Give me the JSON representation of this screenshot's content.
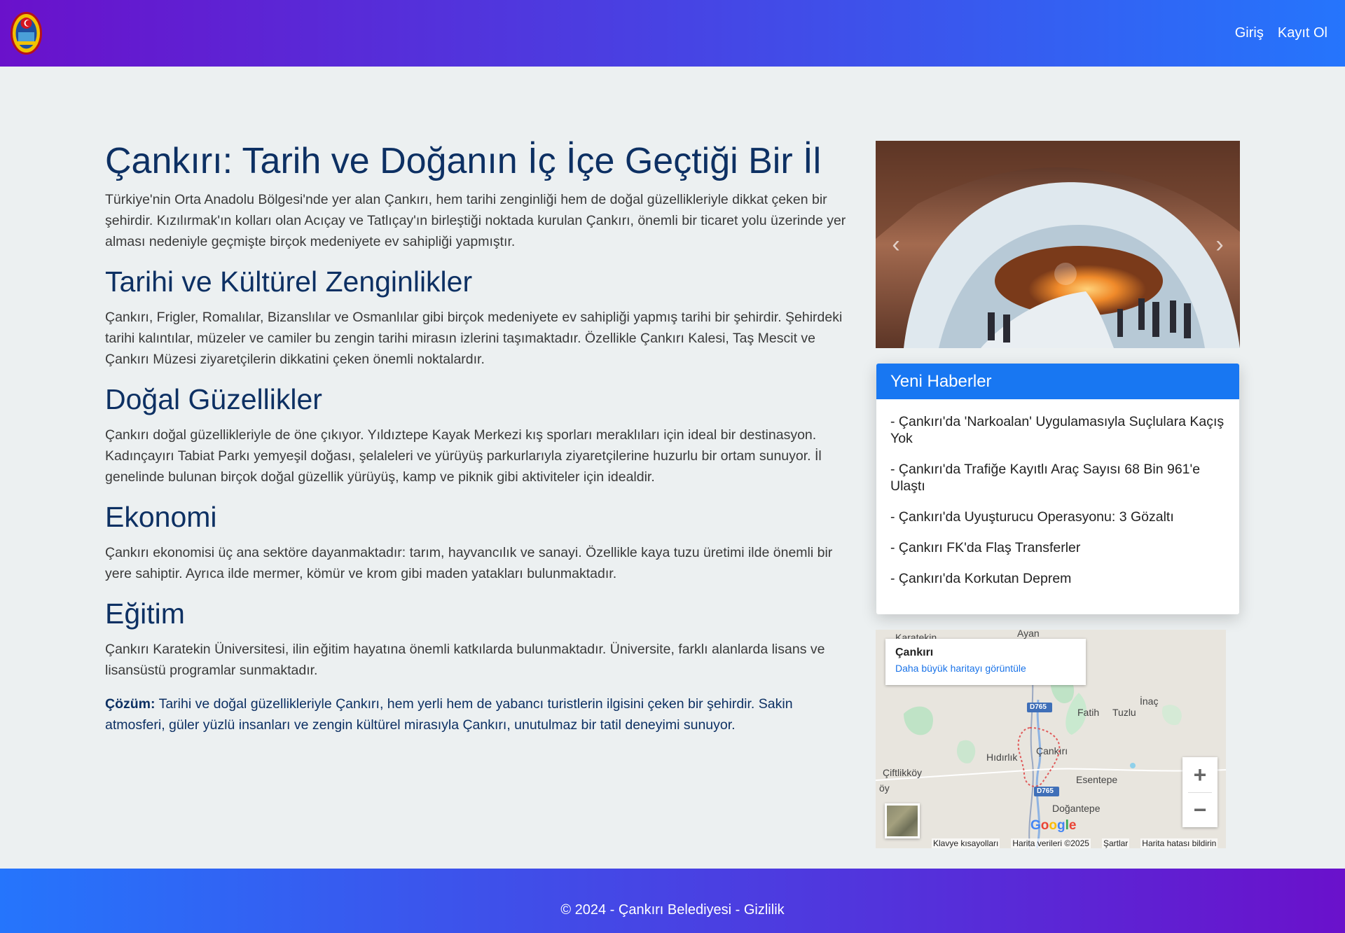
{
  "header": {
    "nav": [
      "Giriş",
      "Kayıt Ol"
    ]
  },
  "main": {
    "title": "Çankırı: Tarih ve Doğanın İç İçe Geçtiği Bir İl",
    "intro": "Türkiye'nin Orta Anadolu Bölgesi'nde yer alan Çankırı, hem tarihi zenginliği hem de doğal güzellikleriyle dikkat çeken bir şehirdir. Kızılırmak'ın kolları olan Acıçay ve Tatlıçay'ın birleştiği noktada kurulan Çankırı, önemli bir ticaret yolu üzerinde yer alması nedeniyle geçmişte birçok medeniyete ev sahipliği yapmıştır.",
    "sections": [
      {
        "heading": "Tarihi ve Kültürel Zenginlikler",
        "text": "Çankırı, Frigler, Romalılar, Bizanslılar ve Osmanlılar gibi birçok medeniyete ev sahipliği yapmış tarihi bir şehirdir. Şehirdeki tarihi kalıntılar, müzeler ve camiler bu zengin tarihi mirasın izlerini taşımaktadır. Özellikle Çankırı Kalesi, Taş Mescit ve Çankırı Müzesi ziyaretçilerin dikkatini çeken önemli noktalardır."
      },
      {
        "heading": "Doğal Güzellikler",
        "text": "Çankırı doğal güzellikleriyle de öne çıkıyor. Yıldıztepe Kayak Merkezi kış sporları meraklıları için ideal bir destinasyon. Kadınçayırı Tabiat Parkı yemyeşil doğası, şelaleleri ve yürüyüş parkurlarıyla ziyaretçilerine huzurlu bir ortam sunuyor. İl genelinde bulunan birçok doğal güzellik yürüyüş, kamp ve piknik gibi aktiviteler için idealdir."
      },
      {
        "heading": "Ekonomi",
        "text": "Çankırı ekonomisi üç ana sektöre dayanmaktadır: tarım, hayvancılık ve sanayi. Özellikle kaya tuzu üretimi ilde önemli bir yere sahiptir. Ayrıca ilde mermer, kömür ve krom gibi maden yatakları bulunmaktadır."
      },
      {
        "heading": "Eğitim",
        "text": "Çankırı Karatekin Üniversitesi, ilin eğitim hayatına önemli katkılarda bulunmaktadır. Üniversite, farklı alanlarda lisans ve lisansüstü programlar sunmaktadır."
      }
    ],
    "solution_label": "Çözüm:",
    "solution_text": " Tarihi ve doğal güzellikleriyle Çankırı, hem yerli hem de yabancı turistlerin ilgisini çeken bir şehirdir. Sakin atmosferi, güler yüzlü insanları ve zengin kültürel mirasıyla Çankırı, unutulmaz bir tatil deneyimi sunuyor."
  },
  "carousel": {
    "prev": "‹",
    "next": "›"
  },
  "news": {
    "title": "Yeni Haberler",
    "items": [
      "- Çankırı'da 'Narkoalan' Uygulamasıyla Suçlulara Kaçış Yok",
      "- Çankırı'da Trafiğe Kayıtlı Araç Sayısı 68 Bin 961'e Ulaştı",
      "- Çankırı'da Uyuşturucu Operasyonu: 3 Gözaltı",
      "- Çankırı FK'da Flaş Transferler",
      "- Çankırı'da Korkutan Deprem"
    ]
  },
  "map": {
    "place": "Çankırı",
    "link": "Daha büyük haritayı görüntüle",
    "labels": [
      "Karatekin",
      "Ayan",
      "İnaç",
      "Fatih",
      "Tuzlu",
      "Çankırı",
      "Hıdırlık",
      "Çiftlikköy",
      "öy",
      "Esentepe",
      "Doğantepe",
      "D765",
      "D765"
    ],
    "zoom_in": "+",
    "zoom_out": "−",
    "google": "Google",
    "footer": [
      "Klavye kısayolları",
      "Harita verileri ©2025",
      "Şartlar",
      "Harita hatası bildirin"
    ]
  },
  "footer": {
    "text": "© 2024 - Çankırı Belediyesi - Gizlilik"
  }
}
